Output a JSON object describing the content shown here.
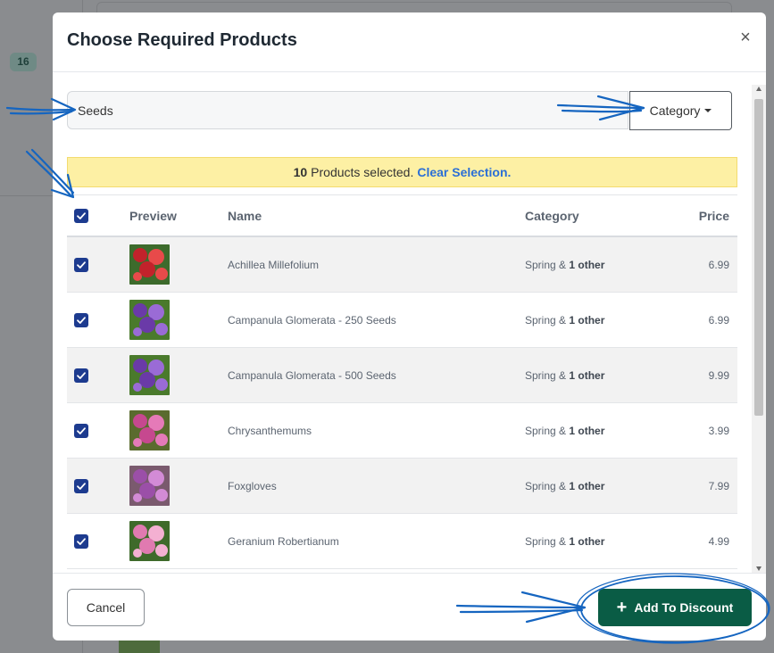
{
  "background": {
    "badge": "16"
  },
  "modal": {
    "title": "Choose Required Products",
    "close_glyph": "×"
  },
  "search": {
    "value": "Seeds"
  },
  "category_button": {
    "label": "Category"
  },
  "selection": {
    "count": "10",
    "text": "Products selected.",
    "clear_label": "Clear Selection."
  },
  "table": {
    "headers": {
      "preview": "Preview",
      "name": "Name",
      "category": "Category",
      "price": "Price"
    },
    "rows": [
      {
        "name": "Achillea Millefolium",
        "category": "Spring &",
        "category_more": "1 other",
        "price": "6.99",
        "thumb_icon": "red-flower-thumbnail",
        "thumb_colors": [
          "#c2222b",
          "#e84a4a",
          "#3d6b2c"
        ]
      },
      {
        "name": "Campanula Glomerata - 250 Seeds",
        "category": "Spring &",
        "category_more": "1 other",
        "price": "6.99",
        "thumb_icon": "purple-bellflower-thumbnail",
        "thumb_colors": [
          "#6a3aa8",
          "#9a6bd6",
          "#4a7a2c"
        ]
      },
      {
        "name": "Campanula Glomerata - 500 Seeds",
        "category": "Spring &",
        "category_more": "1 other",
        "price": "9.99",
        "thumb_icon": "purple-bellflower-thumbnail",
        "thumb_colors": [
          "#6a3aa8",
          "#9a6bd6",
          "#4a7a2c"
        ]
      },
      {
        "name": "Chrysanthemums",
        "category": "Spring &",
        "category_more": "1 other",
        "price": "3.99",
        "thumb_icon": "pink-chrysanthemum-thumbnail",
        "thumb_colors": [
          "#c6488f",
          "#e57ab8",
          "#5a6b2e"
        ]
      },
      {
        "name": "Foxgloves",
        "category": "Spring &",
        "category_more": "1 other",
        "price": "7.99",
        "thumb_icon": "foxglove-thumbnail",
        "thumb_colors": [
          "#9b4fa8",
          "#d38bd6",
          "#7a5a6e"
        ]
      },
      {
        "name": "Geranium Robertianum",
        "category": "Spring &",
        "category_more": "1 other",
        "price": "4.99",
        "thumb_icon": "pink-geranium-thumbnail",
        "thumb_colors": [
          "#e07ab0",
          "#f4b0d2",
          "#3e6a2a"
        ]
      }
    ]
  },
  "footer": {
    "cancel_label": "Cancel",
    "add_label": "Add To Discount",
    "add_icon": "plus-icon"
  },
  "colors": {
    "primary_green": "#0a5c45",
    "checkbox_blue": "#1d3b8f",
    "link_blue": "#2b6fd6",
    "banner_yellow": "#fdf0a4",
    "annotation_blue": "#1565c0"
  }
}
